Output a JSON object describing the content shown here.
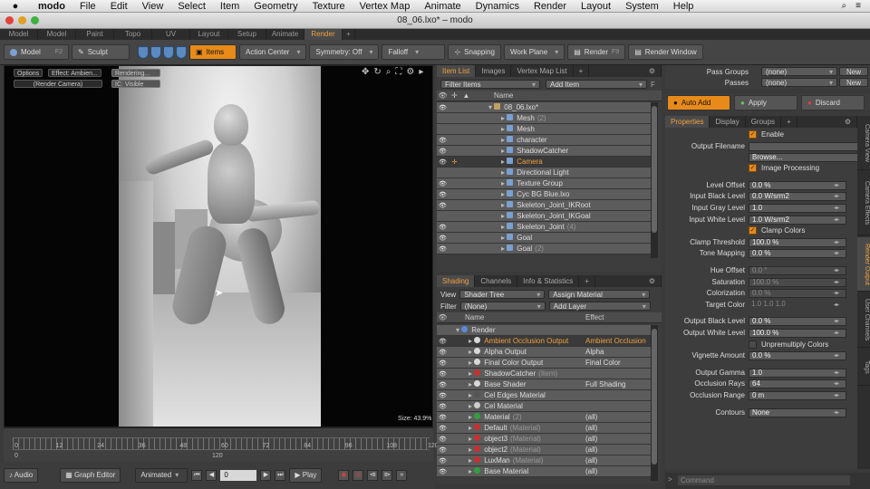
{
  "menubar": {
    "app": "modo",
    "items": [
      "File",
      "Edit",
      "View",
      "Select",
      "Item",
      "Geometry",
      "Texture",
      "Vertex Map",
      "Animate",
      "Dynamics",
      "Render",
      "Layout",
      "System",
      "Help"
    ]
  },
  "window": {
    "title": "08_06.lxo* – modo"
  },
  "layout_tabs": [
    "Model",
    "Model Quad",
    "Paint",
    "Topo",
    "UV",
    "Layout",
    "Setup",
    "Animate",
    "Render"
  ],
  "layout_active": "Render",
  "toolbar": {
    "model": "Model",
    "model_key": "F2",
    "sculpt": "Sculpt",
    "items": "Items",
    "action_center": "Action Center",
    "symmetry": "Symmetry: Off",
    "falloff": "Falloff",
    "snapping": "Snapping",
    "work_plane": "Work Plane",
    "render": "Render",
    "render_key": "F9",
    "render_window": "Render Window"
  },
  "viewport": {
    "options": "Options",
    "effect": "Effect: Ambien...",
    "rendering": "Rendering...",
    "camera": "(Render Camera)",
    "ic": "IC: Visible",
    "size": "Size: 43.9%"
  },
  "timeline": {
    "ticks": [
      "0",
      "12",
      "24",
      "36",
      "48",
      "60",
      "72",
      "84",
      "96",
      "108",
      "120"
    ],
    "ticks2": [
      "0",
      "",
      "120"
    ]
  },
  "bottombar": {
    "audio": "Audio",
    "graph_editor": "Graph Editor",
    "animated": "Animated",
    "frame": "0",
    "play": "Play"
  },
  "itemlist": {
    "tabs": [
      "Item List",
      "Images",
      "Vertex Map List"
    ],
    "filter": "Filter Items",
    "add": "Add Item",
    "col_name": "Name",
    "rows": [
      {
        "name": "08_06.lxo*",
        "extra": "",
        "depth": 0,
        "eye": "●",
        "sel": false
      },
      {
        "name": "Mesh",
        "extra": "(2)",
        "depth": 1,
        "eye": "",
        "sel": false
      },
      {
        "name": "Mesh",
        "extra": "",
        "depth": 1,
        "eye": "",
        "sel": false
      },
      {
        "name": "character",
        "extra": "",
        "depth": 1,
        "eye": "●",
        "sel": false
      },
      {
        "name": "ShadowCatcher",
        "extra": "",
        "depth": 1,
        "eye": "●",
        "sel": false
      },
      {
        "name": "Camera",
        "extra": "",
        "depth": 1,
        "eye": "●",
        "sel": true
      },
      {
        "name": "Directional Light",
        "extra": "",
        "depth": 1,
        "eye": "",
        "sel": false
      },
      {
        "name": "Texture Group",
        "extra": "",
        "depth": 1,
        "eye": "●",
        "sel": false
      },
      {
        "name": "Cyc BG Blue.lxo",
        "extra": "",
        "depth": 1,
        "eye": "●",
        "sel": false
      },
      {
        "name": "Skeleton_Joint_IKRoot",
        "extra": "",
        "depth": 1,
        "eye": "●",
        "sel": false
      },
      {
        "name": "Skeleton_Joint_IKGoal",
        "extra": "",
        "depth": 1,
        "eye": "",
        "sel": false
      },
      {
        "name": "Skeleton_Joint",
        "extra": "(4)",
        "depth": 1,
        "eye": "●",
        "sel": false
      },
      {
        "name": "Goal",
        "extra": "",
        "depth": 1,
        "eye": "●",
        "sel": false
      },
      {
        "name": "Goal",
        "extra": "(2)",
        "depth": 1,
        "eye": "●",
        "sel": false
      }
    ]
  },
  "shading": {
    "tabs": [
      "Shading",
      "Channels",
      "Info & Statistics"
    ],
    "view_label": "View",
    "view": "Shader Tree",
    "assign": "Assign Material",
    "filter_label": "Filter",
    "filter": "(None)",
    "add_layer": "Add Layer",
    "col_name": "Name",
    "col_effect": "Effect",
    "rows": [
      {
        "name": "Render",
        "extra": "",
        "effect": "",
        "color": "#5a8ad8",
        "sel": false,
        "depth": 0
      },
      {
        "name": "Ambient Occlusion Output",
        "extra": "",
        "effect": "Ambient Occlusion",
        "color": "#d8d8d8",
        "sel": true,
        "depth": 1
      },
      {
        "name": "Alpha Output",
        "extra": "",
        "effect": "Alpha",
        "color": "#d8d8d8",
        "sel": false,
        "depth": 1
      },
      {
        "name": "Final Color Output",
        "extra": "",
        "effect": "Final Color",
        "color": "#d8d8d8",
        "sel": false,
        "depth": 1
      },
      {
        "name": "ShadowCatcher",
        "extra": "(Item)",
        "effect": "",
        "color": "#c83030",
        "sel": false,
        "depth": 1
      },
      {
        "name": "Base Shader",
        "extra": "",
        "effect": "Full Shading",
        "color": "#d8d8d8",
        "sel": false,
        "depth": 1
      },
      {
        "name": "Cel Edges Material",
        "extra": "",
        "effect": "",
        "color": "#555555",
        "sel": false,
        "depth": 1
      },
      {
        "name": "Cel Material",
        "extra": "",
        "effect": "",
        "color": "#cccccc",
        "sel": false,
        "depth": 1
      },
      {
        "name": "Material",
        "extra": "(2)",
        "effect": "(all)",
        "color": "#30a040",
        "sel": false,
        "depth": 1
      },
      {
        "name": "Default",
        "extra": "(Material)",
        "effect": "(all)",
        "color": "#c83030",
        "sel": false,
        "depth": 1
      },
      {
        "name": "object3",
        "extra": "(Material)",
        "effect": "(all)",
        "color": "#c83030",
        "sel": false,
        "depth": 1
      },
      {
        "name": "object2",
        "extra": "(Material)",
        "effect": "(all)",
        "color": "#c83030",
        "sel": false,
        "depth": 1
      },
      {
        "name": "LuxMan",
        "extra": "(Material)",
        "effect": "(all)",
        "color": "#c83030",
        "sel": false,
        "depth": 1
      },
      {
        "name": "Base Material",
        "extra": "",
        "effect": "(all)",
        "color": "#30a040",
        "sel": false,
        "depth": 1
      }
    ]
  },
  "passes": {
    "pass_groups_label": "Pass Groups",
    "pass_groups": "(none)",
    "passes_label": "Passes",
    "passes": "(none)",
    "new": "New"
  },
  "actions": {
    "auto_add": "Auto Add",
    "apply": "Apply",
    "discard": "Discard"
  },
  "props_tabs": [
    "Properties",
    "Display",
    "Groups"
  ],
  "properties": [
    {
      "type": "check",
      "label": "",
      "text": "Enable",
      "on": true
    },
    {
      "type": "file",
      "label": "Output Filename",
      "value": "",
      "button": "Browse..."
    },
    {
      "type": "check",
      "label": "",
      "text": "Image Processing",
      "on": true
    },
    {
      "type": "gap"
    },
    {
      "type": "value",
      "label": "Level Offset",
      "value": "0.0 %"
    },
    {
      "type": "value",
      "label": "Input Black Level",
      "value": "0.0 W/srm2"
    },
    {
      "type": "value",
      "label": "Input Gray Level",
      "value": "1.0"
    },
    {
      "type": "value",
      "label": "Input White Level",
      "value": "1.0 W/srm2"
    },
    {
      "type": "check",
      "label": "",
      "text": "Clamp Colors",
      "on": true
    },
    {
      "type": "value",
      "label": "Clamp Threshold",
      "value": "100.0 %"
    },
    {
      "type": "value",
      "label": "Tone Mapping",
      "value": "0.0 %"
    },
    {
      "type": "gap"
    },
    {
      "type": "dim",
      "label": "Hue Offset",
      "value": "0.0 °"
    },
    {
      "type": "dim",
      "label": "Saturation",
      "value": "100.0 %"
    },
    {
      "type": "dim",
      "label": "Colorization",
      "value": "0.0 %"
    },
    {
      "type": "rgb",
      "label": "Target Color",
      "value": "1.0     1.0     1.0"
    },
    {
      "type": "gap"
    },
    {
      "type": "value",
      "label": "Output Black Level",
      "value": "0.0 %"
    },
    {
      "type": "value",
      "label": "Output White Level",
      "value": "100.0 %"
    },
    {
      "type": "check",
      "label": "",
      "text": "Unpremultiply Colors",
      "on": false
    },
    {
      "type": "value",
      "label": "Vignette Amount",
      "value": "0.0 %"
    },
    {
      "type": "gap"
    },
    {
      "type": "value",
      "label": "Output Gamma",
      "value": "1.0"
    },
    {
      "type": "value",
      "label": "Occlusion Rays",
      "value": "64"
    },
    {
      "type": "value",
      "label": "Occlusion Range",
      "value": "0 m"
    },
    {
      "type": "gap"
    },
    {
      "type": "value",
      "label": "Contours",
      "value": "None"
    }
  ],
  "side_tabs": [
    "Camera View",
    "Camera Effects",
    "Render Output",
    "User Channels",
    "Tags"
  ],
  "side_active": "Render Output",
  "command": "Command",
  "colors": {
    "accent": "#e88a1a",
    "panel": "#3d3d3d",
    "selected_text": "#f0a040"
  }
}
